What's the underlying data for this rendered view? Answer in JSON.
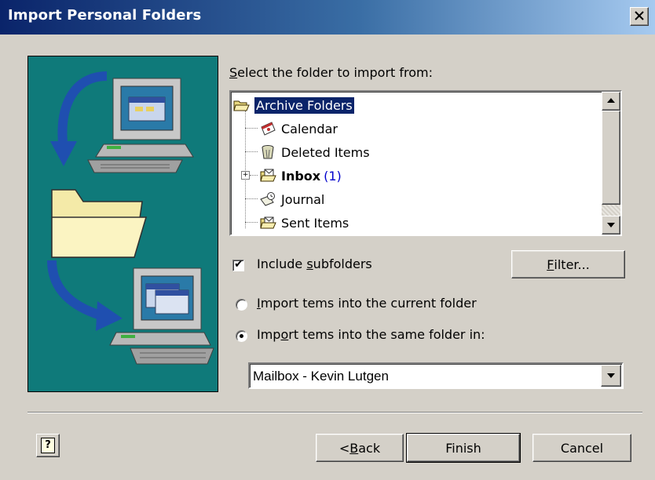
{
  "window": {
    "title": "Import Personal Folders",
    "close_glyph": "✕"
  },
  "tree_section": {
    "label_prefix": "",
    "label_access": "S",
    "label_rest": "elect the folder to import from:",
    "items": [
      {
        "label": "Archive Folders",
        "icon": "open-folder-icon",
        "selected": true
      },
      {
        "label": "Calendar",
        "icon": "calendar-icon"
      },
      {
        "label": "Deleted Items",
        "icon": "trash-icon"
      },
      {
        "label": "Inbox",
        "count": "(1)",
        "icon": "inbox-folder-icon",
        "bold": true,
        "expandable": true
      },
      {
        "label": "Journal",
        "icon": "journal-icon"
      },
      {
        "label": "Sent Items",
        "icon": "sent-folder-icon"
      }
    ]
  },
  "options": {
    "subfolders_pre": "Include ",
    "subfolders_access": "s",
    "subfolders_post": "ubfolders",
    "subfolders_checked": true,
    "filter_access": "F",
    "filter_rest": "ilter...",
    "radio1_access": "I",
    "radio1_rest": "mport tems into the current folder",
    "radio1_selected": false,
    "radio2_pre": "Imp",
    "radio2_access": "o",
    "radio2_rest": "rt tems into the same folder in:",
    "radio2_selected": true,
    "mailbox_value": "Mailbox - Kevin Lutgen"
  },
  "footer": {
    "back_pre": "< ",
    "back_access": "B",
    "back_rest": "ack",
    "finish_label": "Finish",
    "cancel_label": "Cancel",
    "help_glyph": "?"
  },
  "colors": {
    "titlebar_start": "#0a246a",
    "titlebar_end": "#a6caf0",
    "dialog_bg": "#d4d0c8",
    "illustration_bg": "#0f7a7a",
    "selection": "#0a246a"
  }
}
